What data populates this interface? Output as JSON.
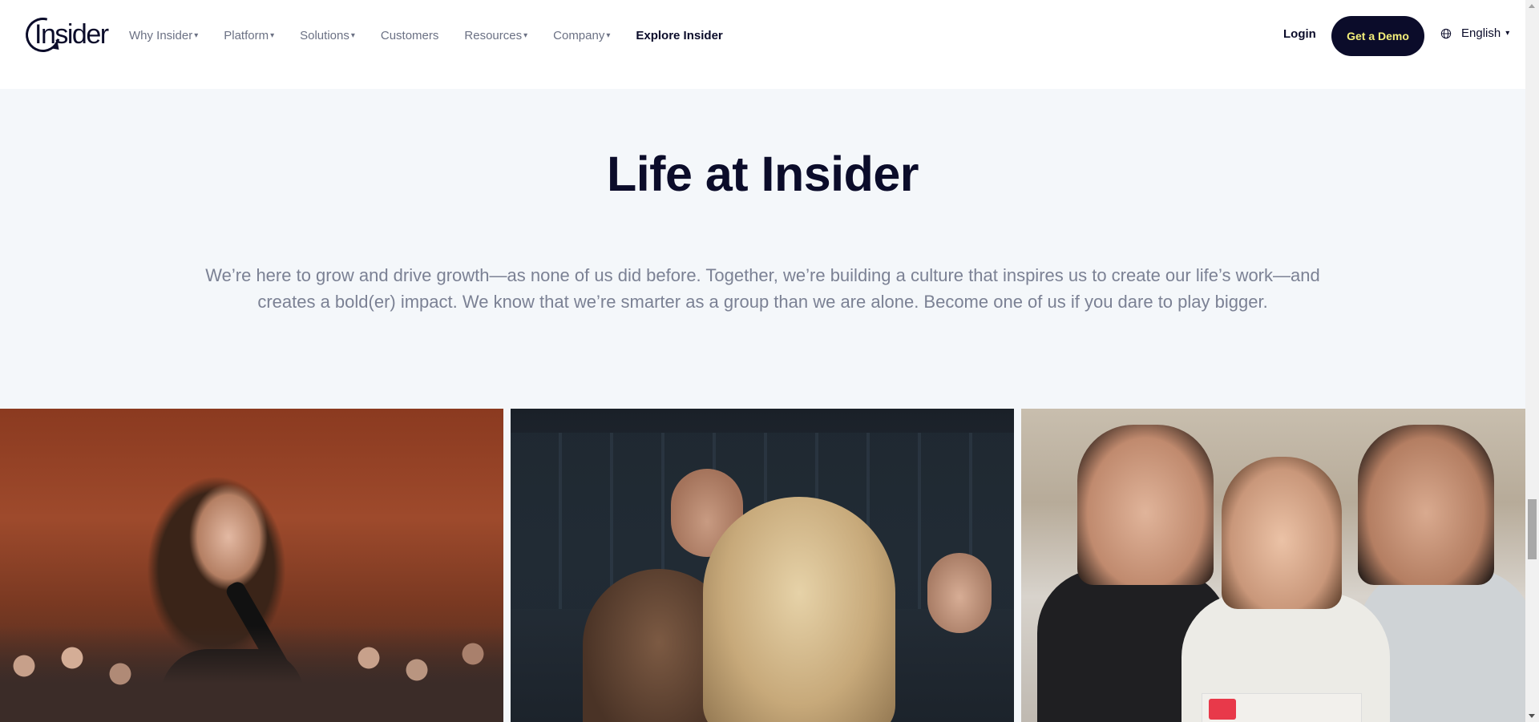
{
  "header": {
    "logo_text": "Insider",
    "nav": [
      {
        "label": "Why Insider",
        "caret": "▾"
      },
      {
        "label": "Platform",
        "caret": "▾"
      },
      {
        "label": "Solutions",
        "caret": "▾"
      },
      {
        "label": "Customers",
        "caret": ""
      },
      {
        "label": "Resources",
        "caret": "▾"
      },
      {
        "label": "Company",
        "caret": "▾"
      },
      {
        "label": "Explore Insider",
        "caret": ""
      }
    ],
    "login_label": "Login",
    "demo_label": "Get a Demo",
    "language": {
      "label": "English",
      "icon": "globe-icon",
      "caret": "▾"
    }
  },
  "section": {
    "title": "Life at Insider",
    "intro": "We’re here to grow and drive growth—as none of us did before. Together, we’re building a culture that inspires us to create our life’s work—and creates a bold(er) impact. We know that we’re smarter as a group than we are alone. Become one of us if you dare to play bigger."
  },
  "gallery": {
    "photos": [
      {
        "subject": "woman speaking into microphone in front of audience"
      },
      {
        "subject": "group of colleagues hugging"
      },
      {
        "subject": "three smiling colleagues with certificate"
      }
    ]
  },
  "colors": {
    "brand_dark": "#0b0c2a",
    "demo_text": "#f5f07a",
    "section_bg": "#f4f7fa",
    "muted_text": "#7b8194"
  }
}
